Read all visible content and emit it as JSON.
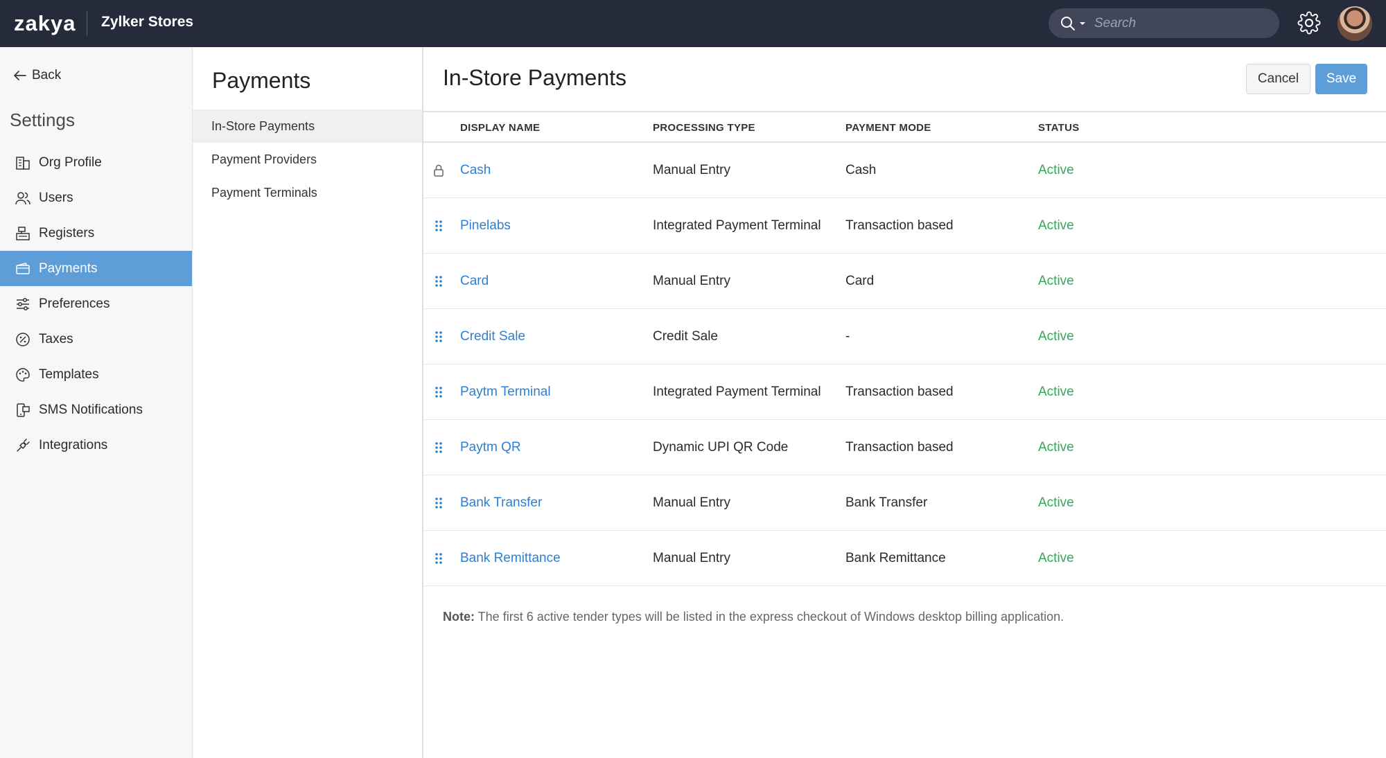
{
  "app": {
    "logo_text": "zakya",
    "org_name": "Zylker Stores"
  },
  "topbar": {
    "search_placeholder": "Search"
  },
  "sidebar": {
    "back_label": "Back",
    "title": "Settings",
    "items": [
      {
        "label": "Org Profile",
        "icon": "building-icon"
      },
      {
        "label": "Users",
        "icon": "users-icon"
      },
      {
        "label": "Registers",
        "icon": "register-icon"
      },
      {
        "label": "Payments",
        "icon": "wallet-icon",
        "active": true
      },
      {
        "label": "Preferences",
        "icon": "sliders-icon"
      },
      {
        "label": "Taxes",
        "icon": "percent-icon"
      },
      {
        "label": "Templates",
        "icon": "palette-icon"
      },
      {
        "label": "SMS Notifications",
        "icon": "sms-icon"
      },
      {
        "label": "Integrations",
        "icon": "plug-icon"
      }
    ]
  },
  "subpanel": {
    "title": "Payments",
    "items": [
      {
        "label": "In-Store Payments",
        "active": true
      },
      {
        "label": "Payment Providers"
      },
      {
        "label": "Payment Terminals"
      }
    ]
  },
  "main": {
    "title": "In-Store Payments",
    "cancel_label": "Cancel",
    "save_label": "Save",
    "columns": [
      "DISPLAY NAME",
      "PROCESSING TYPE",
      "PAYMENT MODE",
      "STATUS"
    ],
    "rows": [
      {
        "name": "Cash",
        "processing": "Manual Entry",
        "mode": "Cash",
        "status": "Active",
        "locked": true
      },
      {
        "name": "Pinelabs",
        "processing": "Integrated Payment Terminal",
        "mode": "Transaction based",
        "status": "Active"
      },
      {
        "name": "Card",
        "processing": "Manual Entry",
        "mode": "Card",
        "status": "Active"
      },
      {
        "name": "Credit Sale",
        "processing": "Credit Sale",
        "mode": "-",
        "status": "Active"
      },
      {
        "name": "Paytm Terminal",
        "processing": "Integrated Payment Terminal",
        "mode": "Transaction based",
        "status": "Active"
      },
      {
        "name": "Paytm QR",
        "processing": "Dynamic UPI QR Code",
        "mode": "Transaction based",
        "status": "Active"
      },
      {
        "name": "Bank Transfer",
        "processing": "Manual Entry",
        "mode": "Bank Transfer",
        "status": "Active"
      },
      {
        "name": "Bank Remittance",
        "processing": "Manual Entry",
        "mode": "Bank Remittance",
        "status": "Active"
      }
    ],
    "note_label": "Note:",
    "note_text": " The first 6 active tender types will be listed in the express checkout of Windows desktop billing application."
  },
  "colors": {
    "topbar": "#262b3c",
    "accent": "#5e9ed8",
    "link": "#2e7fd1",
    "status_active": "#37a65c"
  }
}
